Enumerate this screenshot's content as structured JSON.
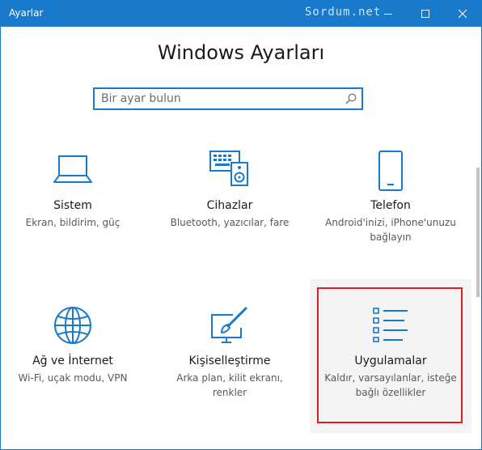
{
  "window": {
    "title": "Ayarlar",
    "watermark": "Sordum.net"
  },
  "page": {
    "heading": "Windows Ayarları"
  },
  "search": {
    "placeholder": "Bir ayar bulun"
  },
  "tiles": [
    {
      "name": "Sistem",
      "desc_lines": [
        "Ekran, bildirim, güç"
      ],
      "icon": "laptop-icon"
    },
    {
      "name": "Cihazlar",
      "desc_lines": [
        "Bluetooth, yazıcılar, fare"
      ],
      "icon": "devices-icon"
    },
    {
      "name": "Telefon",
      "desc_lines": [
        "Android'inizi, iPhone'unuzu",
        "bağlayın"
      ],
      "icon": "phone-icon"
    },
    {
      "name": "Ağ ve İnternet",
      "desc_lines": [
        "Wi-Fi, uçak modu, VPN"
      ],
      "icon": "globe-icon"
    },
    {
      "name": "Kişiselleştirme",
      "desc_lines": [
        "Arka plan, kilit ekranı,",
        "renkler"
      ],
      "icon": "personalization-icon"
    },
    {
      "name": "Uygulamalar",
      "desc_lines": [
        "Kaldır, varsayılanlar, isteğe",
        "bağlı özellikler"
      ],
      "icon": "apps-list-icon"
    }
  ],
  "colors": {
    "accent": "#1979ca",
    "highlight_border": "#e31b23"
  }
}
